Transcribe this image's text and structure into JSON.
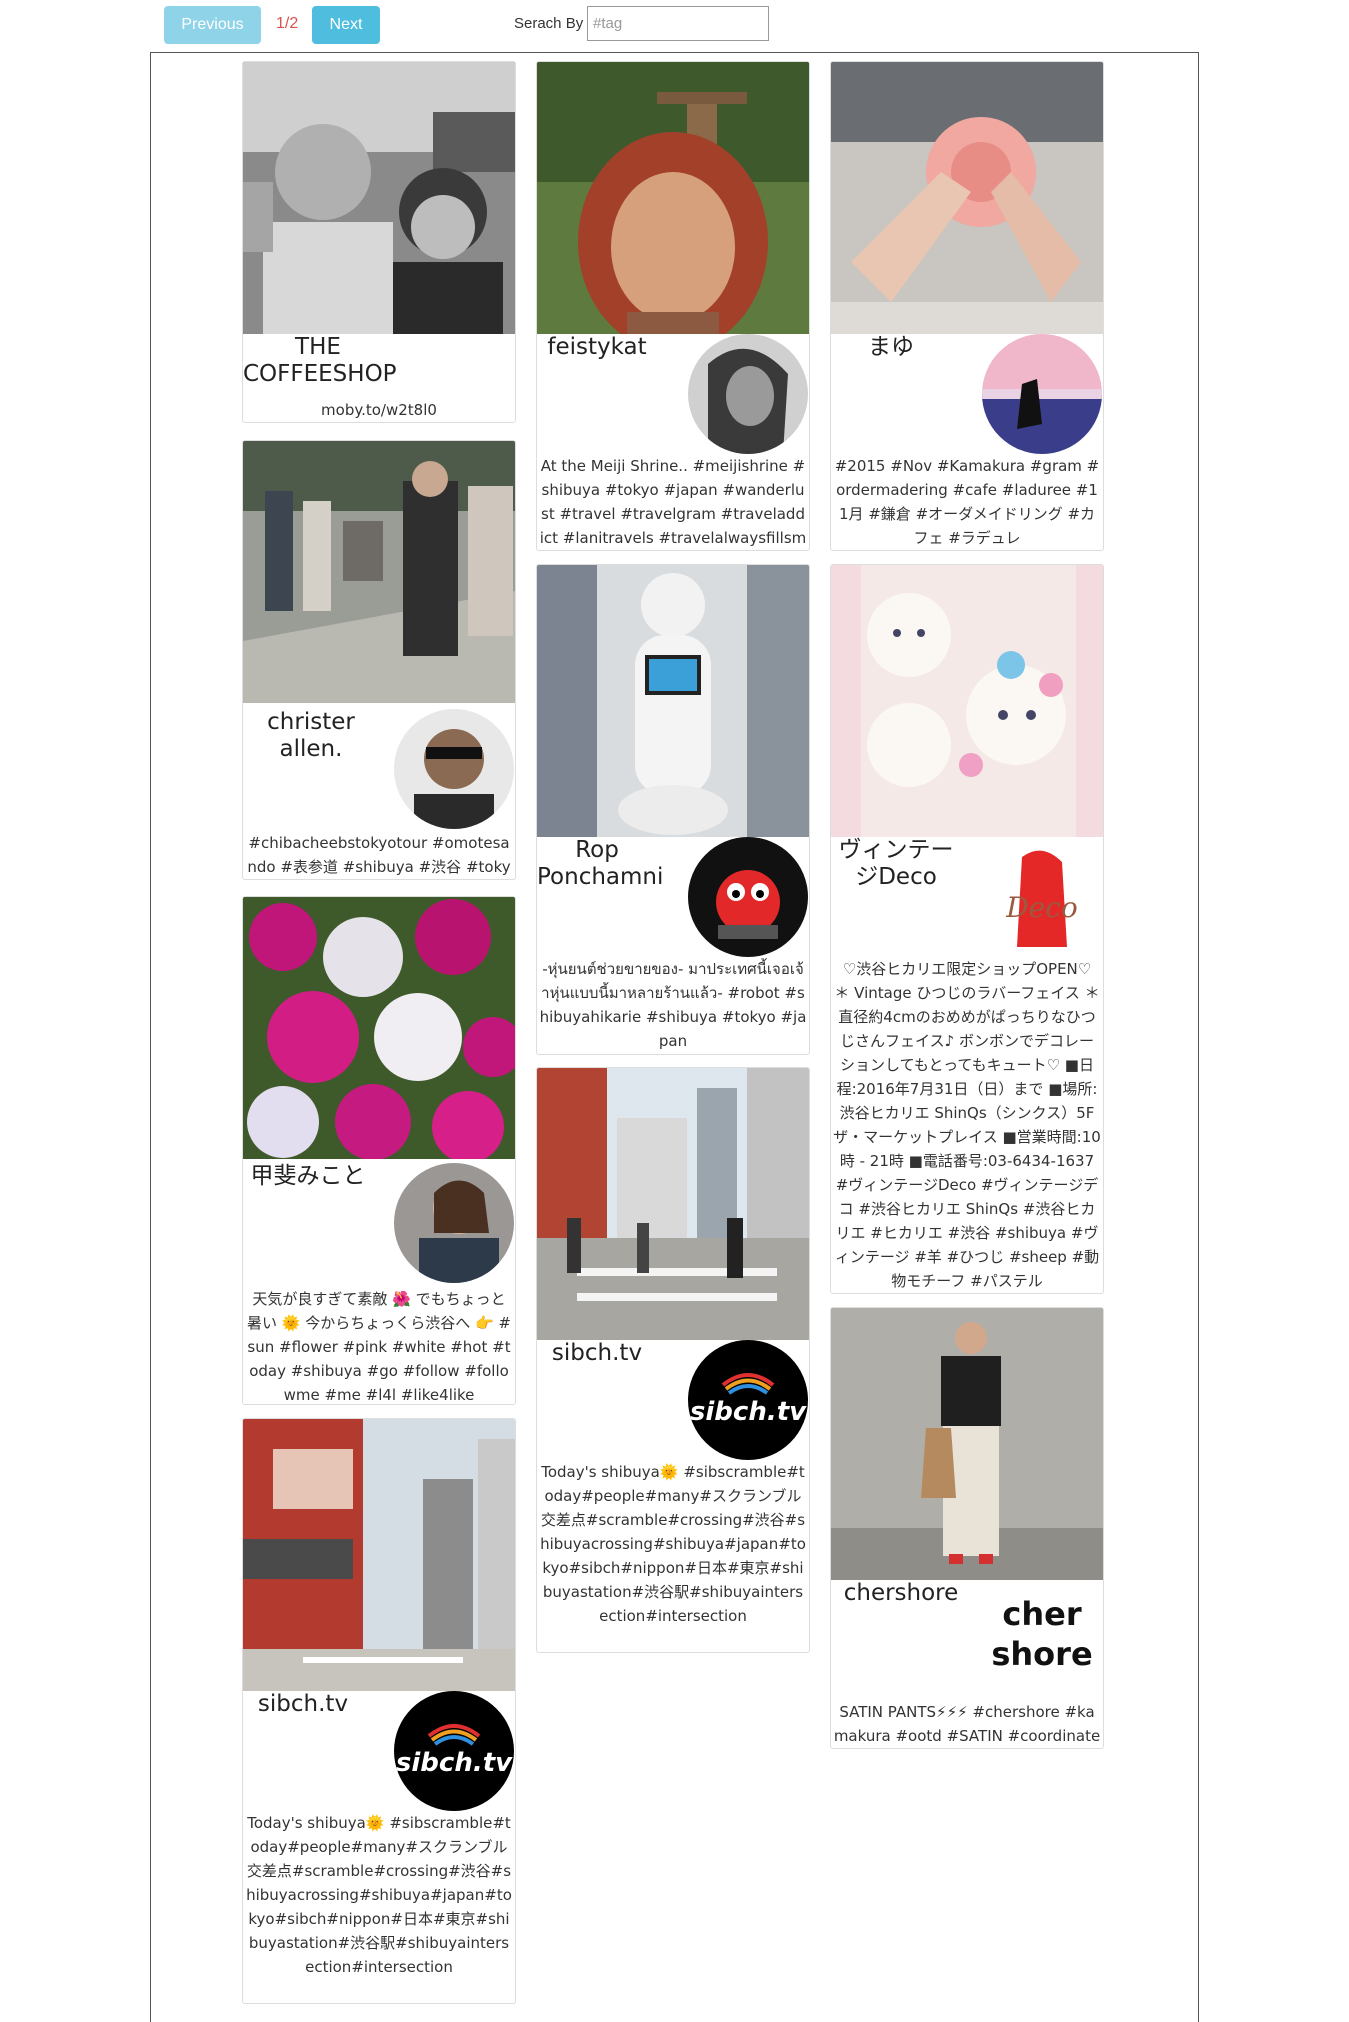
{
  "toolbar": {
    "previous_label": "Previous",
    "page_indicator": "1/2",
    "next_label": "Next",
    "search_label": "Serach By",
    "search_placeholder": "#tag",
    "search_value": ""
  },
  "posts": [
    {
      "author": "THE COFFEESHOP",
      "caption": "moby.to/w2t8l0",
      "photo": "black-and-white-selfie-two-people-icon",
      "avatar": ""
    },
    {
      "author": "christer allen.",
      "caption": "#chibacheebstokyotour #omotesando #表参道 #shibuya #渋谷 #tokyo #東京",
      "photo": "street-walkers-icon",
      "avatar": "man-glasses-portrait-icon"
    },
    {
      "author": "甲斐みこと",
      "caption": "天気が良すぎて素敵 🌺 でもちょっと暑い 🌞 今からちょっくら渋谷へ 👉 #sun #flower #pink #white #hot #today #shibuya #go #follow #followme #me #l4l #like4like",
      "photo": "azalea-flowers-icon",
      "avatar": "woman-portrait-icon"
    },
    {
      "author": "sibch.tv",
      "caption": "Today's shibuya🌞 #sibscramble#today#people#many#スクランブル交差点#scramble#crossing#渋谷#shibuyacrossing#shibuya#japan#tokyo#sibch#nippon#日本#東京#shibuyastation#渋谷駅#shibuyaintersection#intersection",
      "photo": "shibuya-crossing-buildings-icon",
      "avatar": "sibch-tv-logo-icon"
    },
    {
      "author": "feistykat",
      "caption": "At the Meiji Shrine.. #meijishrine #shibuya #tokyo #japan #wanderlust #travel #travelgram #traveladdict #lanitravels #travelalwaysfillsmysoul",
      "photo": "woman-selfie-shrine-icon",
      "avatar": "woman-bw-portrait-icon"
    },
    {
      "author": "Rop Ponchamni",
      "caption": "-หุ่นยนต์ช่วยขายของ- มาประเทศนี้เจอเจ้าหุ่นแบบนี้มาหลายร้านแล้ว- #robot #shibuyahikarie #shibuya #tokyo #japan",
      "photo": "pepper-robot-icon",
      "avatar": "red-crab-mascot-icon"
    },
    {
      "author": "sibch.tv",
      "caption": "Today's shibuya🌞 #sibscramble#today#people#many#スクランブル交差点#scramble#crossing#渋谷#shibuyacrossing#shibuya#japan#tokyo#sibch#nippon#日本#東京#shibuyastation#渋谷駅#shibuyaintersection#intersection",
      "photo": "shibuya-crossing-people-icon",
      "avatar": "sibch-tv-logo-icon"
    },
    {
      "author": "まゆ",
      "caption": "#2015 #Nov #Kamakura #gram #ordermadering #cafe #laduree #11月 #鎌倉 #オーダメイドリング #カフェ #ラデュレ",
      "photo": "hands-rings-rose-icon",
      "avatar": "sunset-silhouette-icon"
    },
    {
      "author": "ヴィンテージDeco",
      "caption": "♡渋谷ヒカリエ限定ショップOPEN♡ ＊ Vintage ひつじのラバーフェイス ＊ 直径約4cmのおめめがぱっちりなひつじさんフェイス♪ ボンボンでデコレーションしてもとってもキュート♡ ■日程:2016年7月31日（日）まで ■場所:渋谷ヒカリエ ShinQs（シンクス）5F ザ・マーケットプレイス ■営業時間:10時 - 21時 ■電話番号:03-6434-1637 #ヴィンテージDeco #ヴィンテージデコ #渋谷ヒカリエ ShinQs #渋谷ヒカリエ #ヒカリエ #渋谷 #shibuya #ヴィンテージ #羊 #ひつじ #sheep #動物モチーフ #パステル",
      "photo": "sheep-faces-icon",
      "avatar": "vintage-deco-logo-icon"
    },
    {
      "author": "chershore",
      "caption": "SATIN PANTS⚡⚡⚡ #chershore #kamakura #ootd #SATIN #coordinate",
      "photo": "fashion-outfit-icon",
      "avatar": "cher-shore-logo-icon"
    }
  ]
}
